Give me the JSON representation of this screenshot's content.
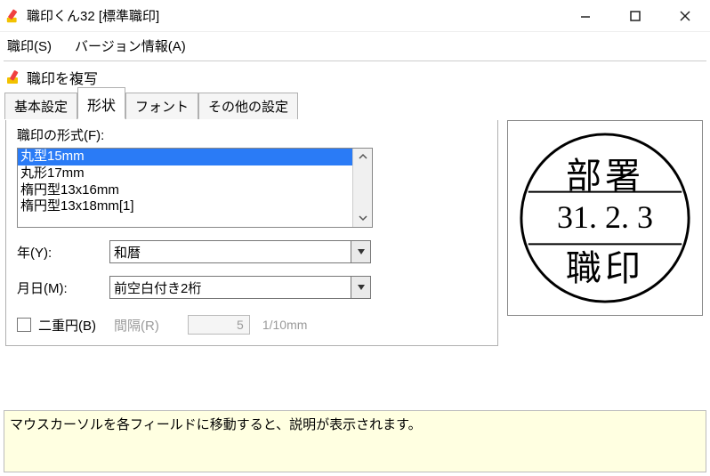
{
  "window": {
    "title": "職印くん32 [標準職印]"
  },
  "menu": {
    "seal": "職印(S)",
    "about": "バージョン情報(A)"
  },
  "heading": "職印を複写",
  "tabs": {
    "basic": "基本設定",
    "shape": "形状",
    "font": "フォント",
    "other": "その他の設定"
  },
  "form": {
    "format_label": "職印の形式(F):",
    "formats": {
      "f0": "丸型15mm",
      "f1": "丸形17mm",
      "f2": "楕円型13x16mm",
      "f3": "楕円型13x18mm[1]"
    },
    "year_label": "年(Y):",
    "year_value": "和暦",
    "md_label": "月日(M):",
    "md_value": "前空白付き2桁",
    "double_label": "二重円(B)",
    "gap_label": "間隔(R)",
    "gap_value": "5",
    "gap_unit": "1/10mm"
  },
  "preview": {
    "top": "部署",
    "mid": "31.  2.  3",
    "bottom": "職印"
  },
  "hint": "マウスカーソルを各フィールドに移動すると、説明が表示されます。"
}
